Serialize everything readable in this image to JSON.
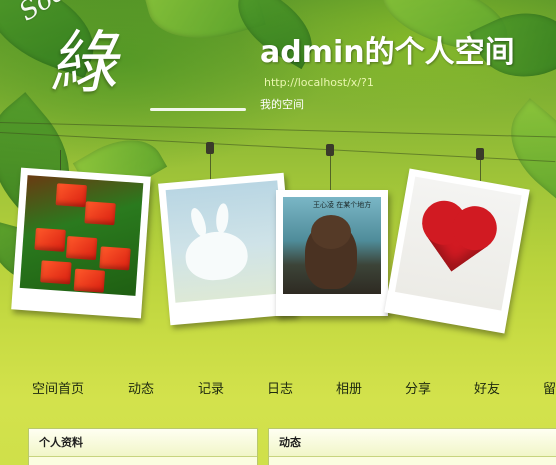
{
  "logo": {
    "script_text": "Sodagreen",
    "glyph": "綠"
  },
  "header": {
    "title": "admin的个人空间",
    "url": "http://localhost/x/?1",
    "subtitle": "我的空间"
  },
  "photos": [
    {
      "name": "red-blocks-photo"
    },
    {
      "name": "white-bunny-photo"
    },
    {
      "name": "teddy-bear-photo",
      "caption": "王心凌 在某个地方"
    },
    {
      "name": "red-heart-photo"
    }
  ],
  "nav": {
    "items": [
      {
        "label": "空间首页"
      },
      {
        "label": "动态"
      },
      {
        "label": "记录"
      },
      {
        "label": "日志"
      },
      {
        "label": "相册"
      },
      {
        "label": "分享"
      },
      {
        "label": "好友"
      },
      {
        "label": "留言板"
      }
    ]
  },
  "panels": {
    "profile_title": "个人资料",
    "feed_title": "动态"
  },
  "colors": {
    "background_top": "#5f9a2a",
    "background_bottom": "#cfe04a",
    "panel_bg": "#fbfde0",
    "panel_border": "#b9c86e"
  }
}
